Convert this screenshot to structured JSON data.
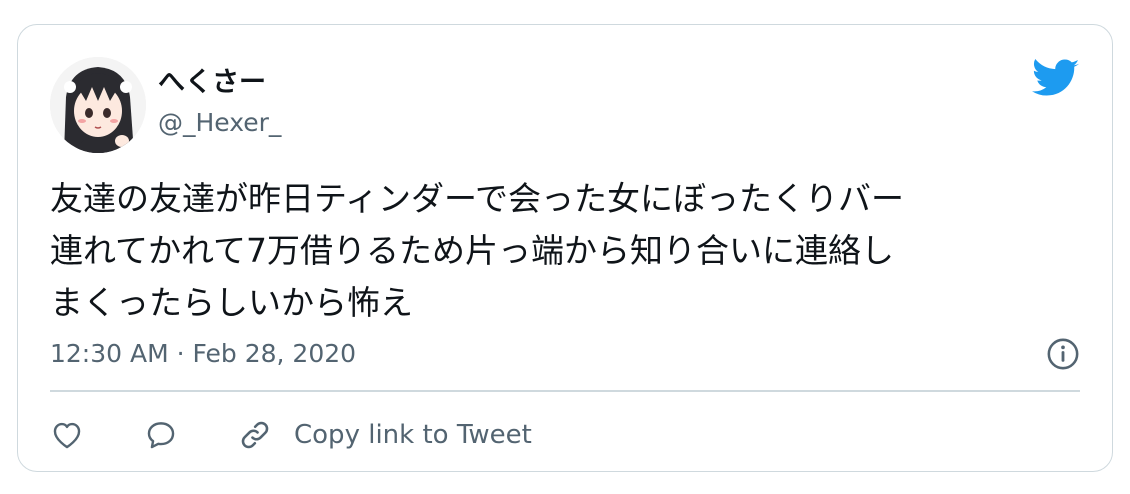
{
  "author": {
    "display_name": "へくさー",
    "handle": "@_Hexer_"
  },
  "tweet": {
    "text_lines": [
      "友達の友達が昨日ティンダーで会った女にぼったくりバー",
      "連れてかれて7万借りるため片っ端から知り合いに連絡し",
      "まくったらしいから怖え"
    ],
    "timestamp": "12:30 AM · Feb 28, 2020"
  },
  "actions": {
    "like_icon": "heart-icon",
    "reply_icon": "speech-bubble-icon",
    "copy_link_icon": "link-icon",
    "copy_link_label": "Copy link to Tweet"
  },
  "colors": {
    "twitter_blue": "#1d9bf0",
    "text_primary": "#0f1419",
    "text_secondary": "#536471",
    "border": "#cfd9de"
  }
}
